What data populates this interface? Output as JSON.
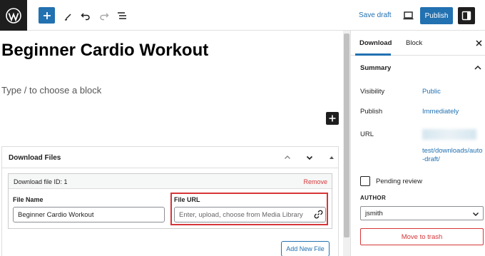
{
  "toolbar": {
    "add_block_label": "+",
    "save_draft": "Save draft",
    "publish": "Publish"
  },
  "editor": {
    "title": "Beginner Cardio Workout",
    "block_placeholder": "Type / to choose a block"
  },
  "metabox": {
    "title": "Download Files",
    "file_id_label": "Download file ID: 1",
    "remove": "Remove",
    "file_name_label": "File Name",
    "file_name_value": "Beginner Cardio Workout",
    "file_url_label": "File URL",
    "file_url_placeholder": "Enter, upload, choose from Media Library",
    "add_new_file": "Add New File"
  },
  "sidebar": {
    "tabs": [
      {
        "label": "Download",
        "active": true
      },
      {
        "label": "Block",
        "active": false
      }
    ],
    "summary_title": "Summary",
    "rows": [
      {
        "label": "Visibility",
        "value": "Public"
      },
      {
        "label": "Publish",
        "value": "Immediately"
      },
      {
        "label": "URL",
        "value": "test/downloads/auto-draft/"
      }
    ],
    "pending_review": "Pending review",
    "author_label": "AUTHOR",
    "author_value": "jsmith",
    "move_to_trash": "Move to trash"
  },
  "colors": {
    "accent": "#2271b1",
    "danger": "#d63638",
    "dark": "#1e1e1e"
  },
  "icons": [
    "wordpress-logo-icon",
    "plus-icon",
    "pen-icon",
    "undo-icon",
    "redo-icon",
    "list-view-icon",
    "preview-icon",
    "settings-icon",
    "close-icon",
    "chevron-up-icon",
    "chevron-down-icon",
    "link-icon"
  ]
}
